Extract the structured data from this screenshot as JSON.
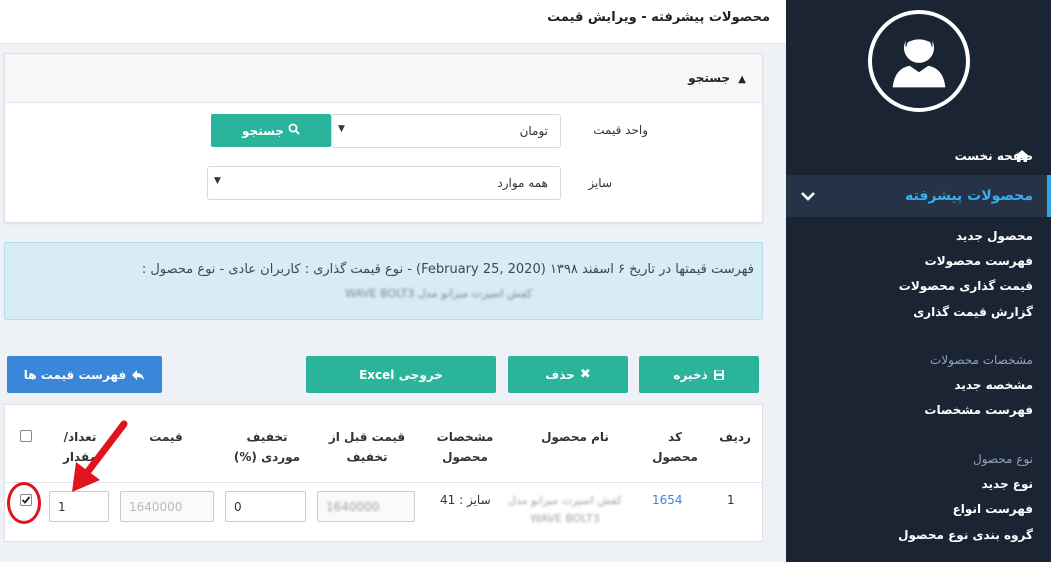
{
  "header": {
    "title": "محصولات پیشرفته - ویرایش قیمت"
  },
  "sidebar": {
    "home_label": "صفحه نخست",
    "active_label": "محصولات پیشرفته",
    "items": [
      "محصول جدید",
      "فهرست محصولات",
      "قیمت گذاری محصولات",
      "گزارش قیمت گذاری"
    ],
    "group1_title": "مشخصات محصولات",
    "group1_items": [
      "مشخصه جدید",
      "فهرست مشخصات"
    ],
    "group2_title": "نوع محصول",
    "group2_items": [
      "نوع جدید",
      "فهرست انواع",
      "گروه بندی نوع محصول"
    ]
  },
  "search": {
    "title": "جستجو",
    "unit_label": "واحد قیمت",
    "unit_value": "تومان",
    "size_label": "سایز",
    "size_value": "همه موارد",
    "button_label": "جستجو"
  },
  "info": {
    "line1": "فهرست قیمتها در تاریخ ۶ اسفند ۱۳۹۸ (February 25, 2020) - نوع قیمت گذاری : کاربران عادی - نوع محصول :",
    "line2": "کفش اسپرت میزانو مدل WAVE BOLT3"
  },
  "actions": {
    "save": "ذخیره",
    "delete": "حذف",
    "excel": "خروجی Excel",
    "price_list": "فهرست قیمت ها"
  },
  "table": {
    "headers": {
      "row": "ردیف",
      "code": "کد محصول",
      "name": "نام محصول",
      "specs": "مشخصات محصول",
      "price_before": "قیمت قبل از تخفیف",
      "discount": "تخفیف موردی (%)",
      "price": "قیمت",
      "qty": "تعداد/ مقدار"
    },
    "rows": [
      {
        "row": "1",
        "code": "1654",
        "name": "کفش اسپرت میزانو مدل WAVE BOLT3",
        "specs": "سایز : 41",
        "price_before": "1640000",
        "discount": "0",
        "price": "1640000",
        "qty": "1",
        "checked": true
      }
    ]
  },
  "colors": {
    "sidebar_bg": "#1b2433",
    "accent_blue": "#3aaeea",
    "teal": "#29b49b",
    "blue_btn": "#3a86d8",
    "info_bg": "#d7ecf5",
    "annotation_red": "#e0141d"
  },
  "icons": [
    "user-avatar-icon",
    "home-icon",
    "chevron-down-icon",
    "caret-up-icon",
    "search-icon",
    "save-icon",
    "times-icon",
    "reply-icon"
  ]
}
